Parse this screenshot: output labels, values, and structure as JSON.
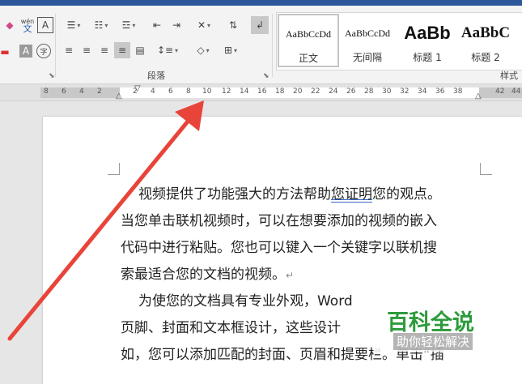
{
  "ribbon": {
    "paragraph_group_label": "段落",
    "styles_group_label": "样式",
    "font_tools": {
      "pinyin_top": "wén",
      "pinyin_bottom": "文",
      "border_a": "A",
      "shade_a": "A",
      "enclose_char": "字"
    },
    "styles": [
      {
        "preview": "AaBbCcDd",
        "name": "正文"
      },
      {
        "preview": "AaBbCcDd",
        "name": "无间隔"
      },
      {
        "preview": "AaBb",
        "name": "标题 1"
      },
      {
        "preview": "AaBbC",
        "name": "标题 2"
      }
    ]
  },
  "ruler": {
    "ticks": [
      "8",
      "6",
      "4",
      "2",
      "2",
      "4",
      "6",
      "8",
      "10",
      "12",
      "14",
      "16",
      "18",
      "20",
      "22",
      "24",
      "26",
      "28",
      "30",
      "32",
      "34",
      "36",
      "38",
      "42",
      "44"
    ]
  },
  "document": {
    "p1_line1_before": "视频提供了功能强大的方法帮助",
    "p1_line1_link": "您证明",
    "p1_line1_after": "您的观点。",
    "p1_line2": "当您单击联机视频时，可以在想要添加的视频的嵌入",
    "p1_line3": "代码中进行粘贴。您也可以键入一个关键字以联机搜",
    "p1_line4": "索最适合您的文档的视频。",
    "p1_mark": "↵",
    "p2_line1": "为使您的文档具有专业外观，Word",
    "p2_line2": "页脚、封面和文本框设计，这些设计",
    "p2_line3": "如，您可以添加匹配的封面、页眉和提要栏。单击“插"
  },
  "watermark": {
    "title": "百科全说",
    "subtitle": "助你轻松解决"
  },
  "colors": {
    "arrow": "#e8443a",
    "watermark_green": "#2d9b3b",
    "title_bar": "#2b579a"
  }
}
